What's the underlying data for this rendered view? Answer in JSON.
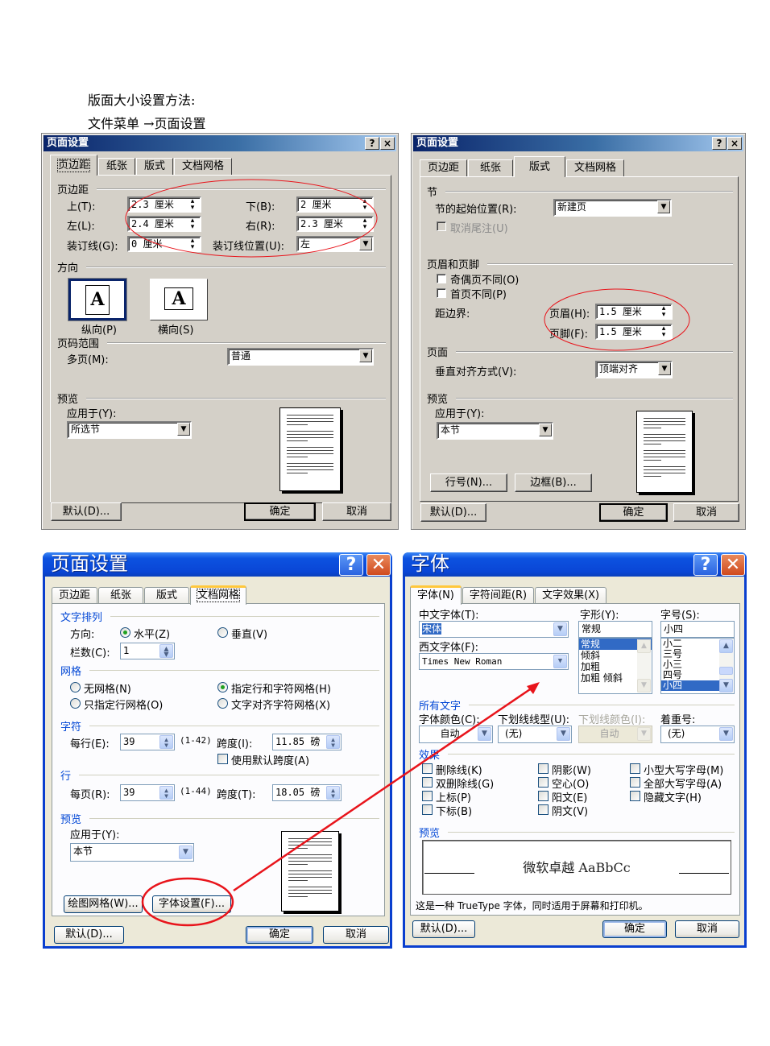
{
  "document": {
    "line1": "版面大小设置方法:",
    "line2": "文件菜单 →页面设置"
  },
  "dialog_margins": {
    "title": "页面设置",
    "help_icon": "?",
    "close_icon": "×",
    "tabs": [
      {
        "label": "页边距",
        "active": true
      },
      {
        "label": "纸张",
        "active": false
      },
      {
        "label": "版式",
        "active": false
      },
      {
        "label": "文档网格",
        "active": false
      }
    ],
    "group_margins": "页边距",
    "top_label": "上(T):",
    "top_value": "2.3 厘米",
    "bottom_label": "下(B):",
    "bottom_value": "2 厘米",
    "left_label": "左(L):",
    "left_value": "2.4 厘米",
    "right_label": "右(R):",
    "right_value": "2.3 厘米",
    "gutter_label": "装订线(G):",
    "gutter_value": "0 厘米",
    "gutter_pos_label": "装订线位置(U):",
    "gutter_pos_value": "左",
    "group_orientation": "方向",
    "portrait_label": "纵向(P)",
    "landscape_label": "横向(S)",
    "orientation_glyph": "A",
    "group_pages": "页码范围",
    "multiple_pages_label": "多页(M):",
    "multiple_pages_value": "普通",
    "group_preview": "预览",
    "apply_to_label": "应用于(Y):",
    "apply_to_value": "所选节",
    "default_button": "默认(D)...",
    "ok_button": "确定",
    "cancel_button": "取消"
  },
  "dialog_layout": {
    "title": "页面设置",
    "help_icon": "?",
    "close_icon": "×",
    "tabs": [
      {
        "label": "页边距",
        "active": false
      },
      {
        "label": "纸张",
        "active": false
      },
      {
        "label": "版式",
        "active": true
      },
      {
        "label": "文档网格",
        "active": false
      }
    ],
    "group_section": "节",
    "section_start_label": "节的起始位置(R):",
    "section_start_value": "新建页",
    "suppress_endnotes_label": "取消尾注(U)",
    "group_headers": "页眉和页脚",
    "odd_even_label": "奇偶页不同(O)",
    "first_page_label": "首页不同(P)",
    "from_edge_label": "距边界:",
    "header_label": "页眉(H):",
    "header_value": "1.5 厘米",
    "footer_label": "页脚(F):",
    "footer_value": "1.5 厘米",
    "group_page": "页面",
    "vertical_align_label": "垂直对齐方式(V):",
    "vertical_align_value": "顶端对齐",
    "group_preview": "预览",
    "apply_to_label": "应用于(Y):",
    "apply_to_value": "本节",
    "line_numbers_button": "行号(N)...",
    "borders_button": "边框(B)...",
    "default_button": "默认(D)...",
    "ok_button": "确定",
    "cancel_button": "取消"
  },
  "dialog_grid": {
    "title": "页面设置",
    "help_icon": "?",
    "close_icon": "✕",
    "tabs": [
      {
        "label": "页边距",
        "active": false
      },
      {
        "label": "纸张",
        "active": false
      },
      {
        "label": "版式",
        "active": false
      },
      {
        "label": "文档网格",
        "active": true
      }
    ],
    "group_text_flow": "文字排列",
    "direction_label": "方向:",
    "horizontal_label": "水平(Z)",
    "vertical_label": "垂直(V)",
    "columns_label": "栏数(C):",
    "columns_value": "1",
    "group_grid": "网格",
    "no_grid_label": "无网格(N)",
    "lines_chars_grid_label": "指定行和字符网格(H)",
    "lines_only_grid_label": "只指定行网格(O)",
    "text_snap_grid_label": "文字对齐字符网格(X)",
    "selected_grid": "lines_chars_grid",
    "group_chars": "字符",
    "chars_per_line_label": "每行(E):",
    "chars_per_line_value": "39",
    "chars_range": "(1-42)",
    "char_pitch_label": "跨度(I):",
    "char_pitch_value": "11.85 磅",
    "use_default_pitch_label": "使用默认跨度(A)",
    "group_lines": "行",
    "lines_per_page_label": "每页(R):",
    "lines_per_page_value": "39",
    "lines_range": "(1-44)",
    "line_pitch_label": "跨度(T):",
    "line_pitch_value": "18.05 磅",
    "group_preview": "预览",
    "apply_to_label": "应用于(Y):",
    "apply_to_value": "本节",
    "draw_grid_button": "绘图网格(W)...",
    "font_settings_button": "字体设置(F)...",
    "default_button": "默认(D)...",
    "ok_button": "确定",
    "cancel_button": "取消"
  },
  "dialog_font": {
    "title": "字体",
    "help_icon": "?",
    "close_icon": "✕",
    "tabs": [
      {
        "label": "字体(N)",
        "active": true
      },
      {
        "label": "字符间距(R)",
        "active": false
      },
      {
        "label": "文字效果(X)",
        "active": false
      }
    ],
    "chinese_font_label": "中文字体(T):",
    "chinese_font_value": "宋体",
    "western_font_label": "西文字体(F):",
    "western_font_value": "Times New Roman",
    "style_label": "字形(Y):",
    "style_value": "常规",
    "style_options": [
      "常规",
      "倾斜",
      "加粗",
      "加粗 倾斜"
    ],
    "style_selected": "常规",
    "size_label": "字号(S):",
    "size_value": "小四",
    "size_options": [
      "小二",
      "三号",
      "小三",
      "四号",
      "小四"
    ],
    "size_selected": "小四",
    "group_all_text": "所有文字",
    "font_color_label": "字体颜色(C):",
    "font_color_value": "自动",
    "underline_style_label": "下划线线型(U):",
    "underline_style_value": "(无)",
    "underline_color_label": "下划线颜色(I):",
    "underline_color_value": "自动",
    "emphasis_label": "着重号:",
    "emphasis_value": "(无)",
    "group_effects": "效果",
    "effects": [
      "删除线(K)",
      "阴影(W)",
      "小型大写字母(M)",
      "双删除线(G)",
      "空心(O)",
      "全部大写字母(A)",
      "上标(P)",
      "阳文(E)",
      "隐藏文字(H)",
      "下标(B)",
      "阴文(V)"
    ],
    "group_preview": "预览",
    "preview_text": "微软卓越 AaBbCc",
    "truetype_note": "这是一种 TrueType 字体，同时适用于屏幕和打印机。",
    "default_button": "默认(D)...",
    "ok_button": "确定",
    "cancel_button": "取消"
  },
  "annotations": {
    "highlight_color": "#e8141b"
  }
}
